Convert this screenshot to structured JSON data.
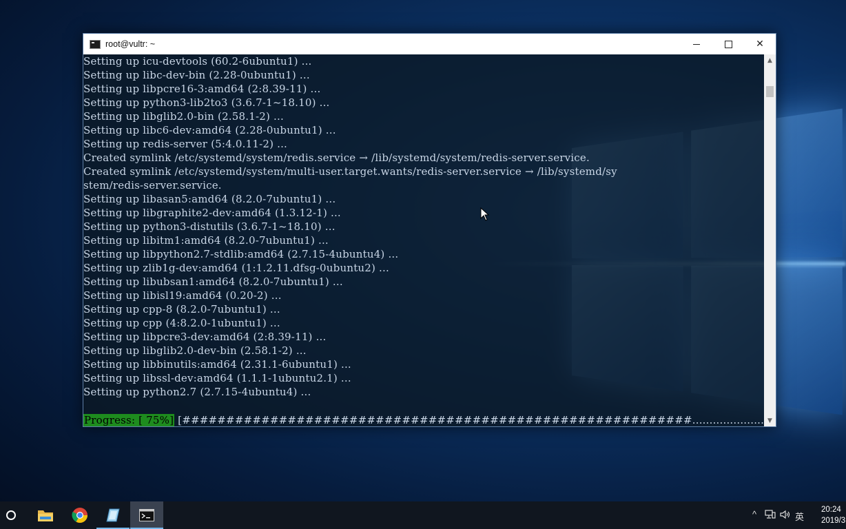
{
  "window": {
    "title": "root@vultr: ~"
  },
  "console": {
    "lines": [
      "Setting up icu-devtools (60.2-6ubuntu1) ...",
      "Setting up libc-dev-bin (2.28-0ubuntu1) ...",
      "Setting up libpcre16-3:amd64 (2:8.39-11) ...",
      "Setting up python3-lib2to3 (3.6.7-1~18.10) ...",
      "Setting up libglib2.0-bin (2.58.1-2) ...",
      "Setting up libc6-dev:amd64 (2.28-0ubuntu1) ...",
      "Setting up redis-server (5:4.0.11-2) ...",
      "Created symlink /etc/systemd/system/redis.service → /lib/systemd/system/redis-server.service.",
      "Created symlink /etc/systemd/system/multi-user.target.wants/redis-server.service → /lib/systemd/sy",
      "stem/redis-server.service.",
      "Setting up libasan5:amd64 (8.2.0-7ubuntu1) ...",
      "Setting up libgraphite2-dev:amd64 (1.3.12-1) ...",
      "Setting up python3-distutils (3.6.7-1~18.10) ...",
      "Setting up libitm1:amd64 (8.2.0-7ubuntu1) ...",
      "Setting up libpython2.7-stdlib:amd64 (2.7.15-4ubuntu4) ...",
      "Setting up zlib1g-dev:amd64 (1:1.2.11.dfsg-0ubuntu2) ...",
      "Setting up libubsan1:amd64 (8.2.0-7ubuntu1) ...",
      "Setting up libisl19:amd64 (0.20-2) ...",
      "Setting up cpp-8 (8.2.0-7ubuntu1) ...",
      "Setting up cpp (4:8.2.0-1ubuntu1) ...",
      "Setting up libpcre3-dev:amd64 (2:8.39-11) ...",
      "Setting up libglib2.0-dev-bin (2.58.1-2) ...",
      "Setting up libbinutils:amd64 (2.31.1-6ubuntu1) ...",
      "Setting up libssl-dev:amd64 (1.1.1-1ubuntu2.1) ...",
      "Setting up python2.7 (2.7.15-4ubuntu4) ..."
    ],
    "progress_label": "Progress: [ 75%]",
    "progress_bar": "[##########################################################.....................]",
    "progress_fraction": 0.75
  },
  "taskbar": {
    "apps": [
      "search-icon",
      "file-explorer-icon",
      "chrome-icon",
      "app-icon",
      "terminal-icon"
    ],
    "tray": {
      "ime": "英",
      "time": "20:24",
      "date": "2019/3"
    }
  },
  "colors": {
    "progress_green": "#1e8c1e",
    "console_text": "#c9d6e6",
    "taskbar": "#10161f"
  }
}
